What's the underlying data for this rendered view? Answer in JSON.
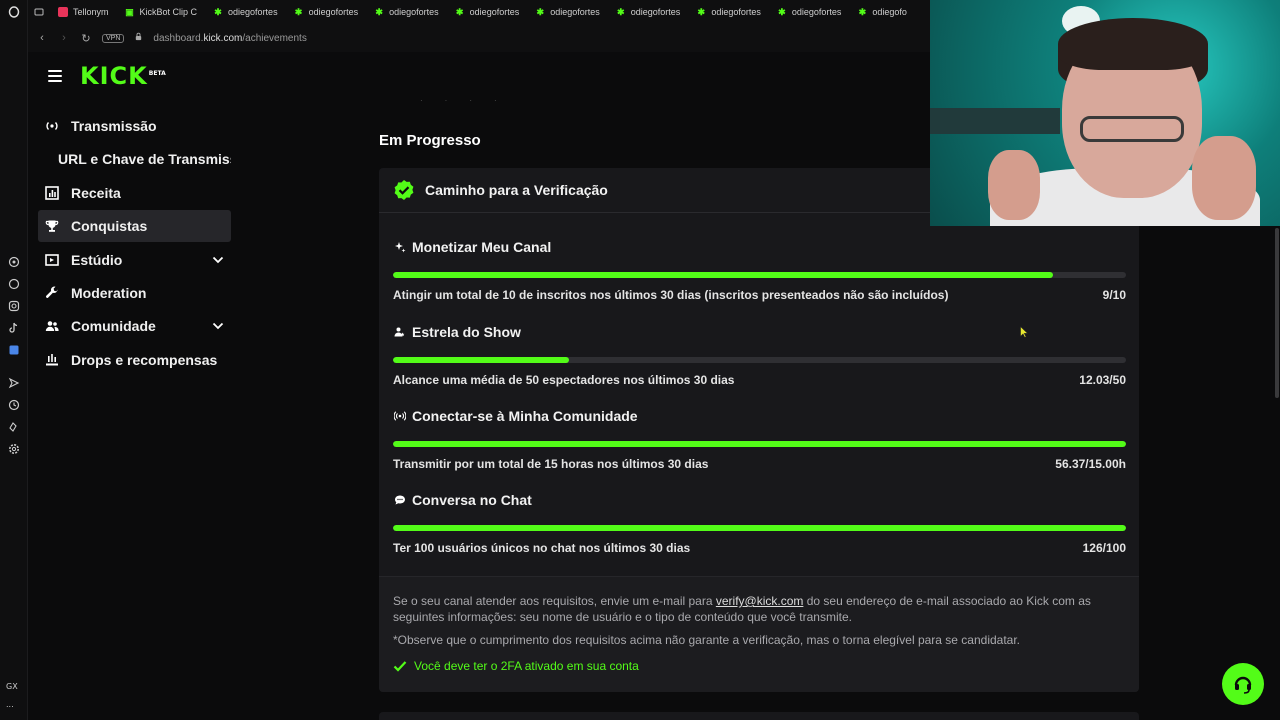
{
  "browser": {
    "tabs": [
      {
        "label": "Tellonym",
        "icon": "tellonym-icon"
      },
      {
        "label": "KickBot Clip C",
        "icon": "kickbot-icon"
      },
      {
        "label": "odiegofortes",
        "icon": "kick-icon"
      },
      {
        "label": "odiegofortes",
        "icon": "kick-icon"
      },
      {
        "label": "odiegofortes",
        "icon": "kick-icon"
      },
      {
        "label": "odiegofortes",
        "icon": "kick-icon"
      },
      {
        "label": "odiegofortes",
        "icon": "kick-icon"
      },
      {
        "label": "odiegofortes",
        "icon": "kick-icon"
      },
      {
        "label": "odiegofortes",
        "icon": "kick-icon"
      },
      {
        "label": "odiegofortes",
        "icon": "kick-icon"
      },
      {
        "label": "odiegofo",
        "icon": "kick-icon"
      }
    ],
    "address": {
      "vpn": "VPN",
      "host": "dashboard.",
      "domain": "kick.com",
      "path": "/achievements"
    },
    "rail_bottom": "GX",
    "rail_more": "..."
  },
  "sidebar": {
    "logo": "KICK",
    "logo_badge": "BETA",
    "items": [
      {
        "label": "Transmissão",
        "icon": "broadcast-icon"
      },
      {
        "label": "URL e Chave de Transmissão",
        "icon": ""
      },
      {
        "label": "Receita",
        "icon": "chart-icon"
      },
      {
        "label": "Conquistas",
        "icon": "trophy-icon",
        "active": true
      },
      {
        "label": "Estúdio",
        "icon": "studio-icon",
        "expandable": true
      },
      {
        "label": "Moderation",
        "icon": "wrench-icon"
      },
      {
        "label": "Comunidade",
        "icon": "community-icon",
        "expandable": true
      },
      {
        "label": "Drops e recompensas",
        "icon": "drops-icon"
      }
    ]
  },
  "main": {
    "section_title": "Em Progresso",
    "card": {
      "title": "Caminho para a Verificação",
      "achievements": [
        {
          "title": "Monetizar Meu Canal",
          "icon": "sparkle-icon",
          "desc": "Atingir um total de 10 de inscritos nos últimos 30 dias (inscritos presenteados não são incluídos)",
          "value": "9/10",
          "progress": 0.9
        },
        {
          "title": "Estrela do Show",
          "icon": "viewers-icon",
          "desc": "Alcance uma média de 50 espectadores nos últimos 30 dias",
          "value": "12.03/50",
          "progress": 0.24
        },
        {
          "title": "Conectar-se à Minha Comunidade",
          "icon": "live-signal-icon",
          "desc": "Transmitir por um total de 15 horas nos últimos 30 dias",
          "value": "56.37/15.00h",
          "progress": 1.0
        },
        {
          "title": "Conversa no Chat",
          "icon": "chat-icon",
          "desc": "Ter 100 usuários únicos no chat nos últimos 30 dias",
          "value": "126/100",
          "progress": 1.0
        }
      ],
      "footer": {
        "text_before": "Se o seu canal atender aos requisitos, envie um e-mail para ",
        "email": "verify@kick.com",
        "text_after": " do seu endereço de e-mail associado ao Kick com as seguintes informações: seu nome de usuário e o tipo de conteúdo que você transmite.",
        "note": "*Observe que o cumprimento dos requisitos acima não garante a verificação, mas o torna elegível para se candidatar.",
        "twofa": "Você deve ter o 2FA ativado em sua conta"
      }
    }
  },
  "colors": {
    "accent": "#53fc18",
    "card": "#18181b",
    "bg": "#0b0b0c"
  }
}
